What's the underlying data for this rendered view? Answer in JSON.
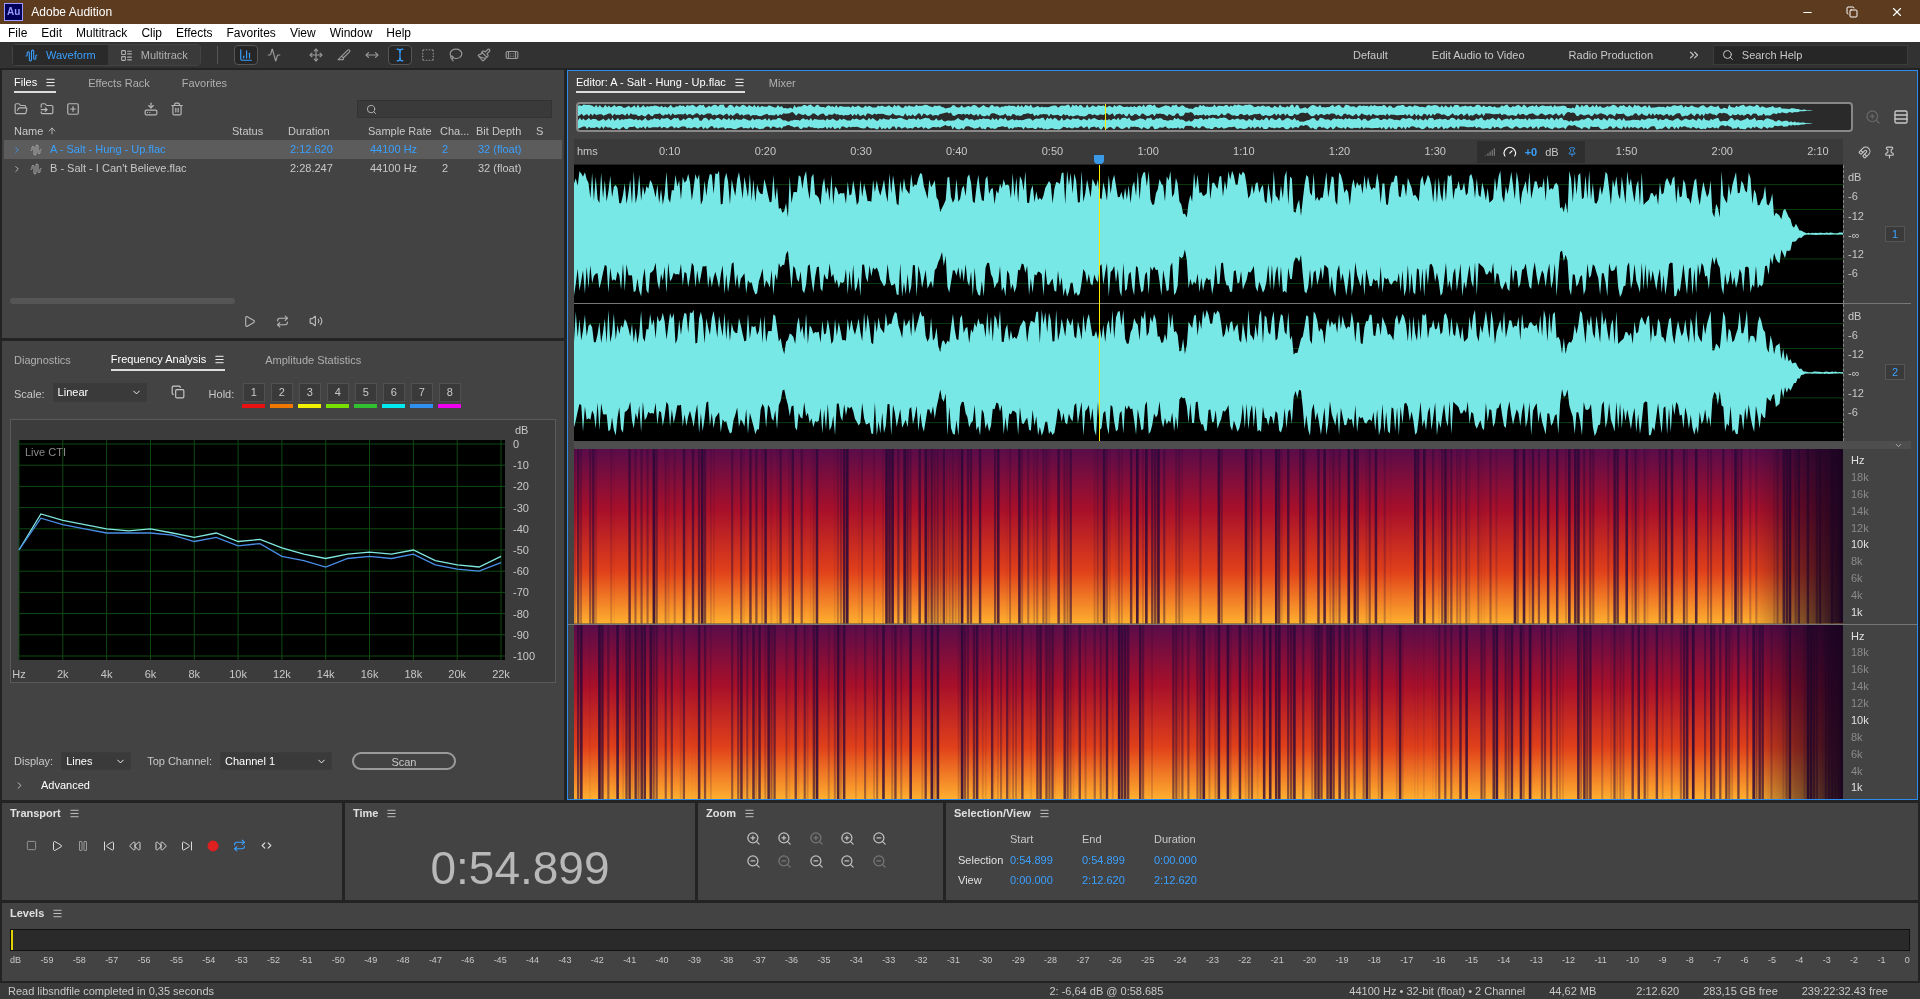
{
  "window": {
    "app_icon": "Au",
    "title": "Adobe Audition"
  },
  "menu": [
    "File",
    "Edit",
    "Multitrack",
    "Clip",
    "Effects",
    "Favorites",
    "View",
    "Window",
    "Help"
  ],
  "toolbar": {
    "modes": [
      {
        "label": "Waveform",
        "selected": true
      },
      {
        "label": "Multitrack",
        "selected": false
      }
    ],
    "workspaces": [
      "Default",
      "Edit Audio to Video",
      "Radio Production"
    ],
    "search": {
      "placeholder": "Search Help"
    }
  },
  "files_panel": {
    "tabs": [
      {
        "label": "Files",
        "selected": true
      },
      {
        "label": "Effects Rack",
        "selected": false
      },
      {
        "label": "Favorites",
        "selected": false
      }
    ],
    "columns": [
      "Name",
      "Status",
      "Duration",
      "Sample Rate",
      "Cha...",
      "Bit Depth",
      "S"
    ],
    "rows": [
      {
        "name": "A - Salt - Hung - Up.flac",
        "duration": "2:12.620",
        "sample_rate": "44100 Hz",
        "channels": "2",
        "bit_depth": "32 (float)",
        "selected": true
      },
      {
        "name": "B - Salt - I Can't Believe.flac",
        "duration": "2:28.247",
        "sample_rate": "44100 Hz",
        "channels": "2",
        "bit_depth": "32 (float)",
        "selected": false
      }
    ]
  },
  "analysis_panel": {
    "tabs": [
      {
        "label": "Diagnostics",
        "selected": false
      },
      {
        "label": "Frequency Analysis",
        "selected": true
      },
      {
        "label": "Amplitude Statistics",
        "selected": false
      }
    ],
    "scale_label": "Scale:",
    "scale": "Linear",
    "hold_label": "Hold:",
    "hold": [
      {
        "label": "1",
        "color": "#e81010"
      },
      {
        "label": "2",
        "color": "#f07800"
      },
      {
        "label": "3",
        "color": "#f0f000"
      },
      {
        "label": "4",
        "color": "#78e000"
      },
      {
        "label": "5",
        "color": "#30c030"
      },
      {
        "label": "6",
        "color": "#00e8f0"
      },
      {
        "label": "7",
        "color": "#3090f0"
      },
      {
        "label": "8",
        "color": "#f000f0"
      }
    ],
    "live_label": "Live CTI",
    "chart_data": {
      "type": "line",
      "grid": true,
      "ylabel": "dB",
      "xlim": [
        0,
        22000
      ],
      "ylim": [
        -100,
        0
      ],
      "x": [
        0,
        1000,
        2000,
        3000,
        4000,
        5000,
        6000,
        7000,
        8000,
        9000,
        10000,
        11000,
        12000,
        13000,
        14000,
        15000,
        16000,
        17000,
        18000,
        19000,
        20000,
        21000,
        22000
      ],
      "series": [
        {
          "color": "#80e8e0",
          "values": [
            -50,
            -33,
            -36,
            -38,
            -40,
            -41,
            -40,
            -42,
            -44,
            -42,
            -46,
            -45,
            -49,
            -52,
            -54,
            -52,
            -51,
            -52,
            -50,
            -55,
            -57,
            -58,
            -53
          ]
        },
        {
          "color": "#4a8ee8",
          "values": [
            -50,
            -35,
            -38,
            -40,
            -42,
            -42,
            -42,
            -43,
            -46,
            -44,
            -48,
            -47,
            -53,
            -55,
            -58,
            -54,
            -53,
            -54,
            -52,
            -57,
            -59,
            -60,
            -56
          ]
        }
      ],
      "xticks": [
        {
          "value": 0,
          "label": "Hz"
        },
        {
          "value": 2000,
          "label": "2k"
        },
        {
          "value": 4000,
          "label": "4k"
        },
        {
          "value": 6000,
          "label": "6k"
        },
        {
          "value": 8000,
          "label": "8k"
        },
        {
          "value": 10000,
          "label": "10k"
        },
        {
          "value": 12000,
          "label": "12k"
        },
        {
          "value": 14000,
          "label": "14k"
        },
        {
          "value": 16000,
          "label": "16k"
        },
        {
          "value": 18000,
          "label": "18k"
        },
        {
          "value": 20000,
          "label": "20k"
        },
        {
          "value": 22000,
          "label": "22k"
        }
      ],
      "yticks": [
        0,
        -10,
        -20,
        -30,
        -40,
        -50,
        -60,
        -70,
        -80,
        -90,
        -100
      ]
    },
    "display_label": "Display:",
    "display": "Lines",
    "top_channel_label": "Top Channel:",
    "top_channel": "Channel 1",
    "scan": "Scan",
    "advanced": "Advanced"
  },
  "editor": {
    "tabs": [
      {
        "label": "Editor: A - Salt - Hung - Up.flac",
        "selected": true
      },
      {
        "label": "Mixer",
        "selected": false
      }
    ],
    "ruler_unit": "hms",
    "ruler": [
      "0:10",
      "0:20",
      "0:30",
      "0:40",
      "0:50",
      "1:00",
      "1:10",
      "1:20",
      "1:30",
      "1:50",
      "2:00",
      "2:10"
    ],
    "playhead": {
      "level": 0.414
    },
    "gain": "+0",
    "gain_unit": "dB",
    "channels": [
      {
        "badge": "1",
        "labels": [
          "dB",
          "-6",
          "-12",
          "-∞",
          "-12",
          "-6"
        ]
      },
      {
        "badge": "2",
        "labels": [
          "dB",
          "-6",
          "-12",
          "-∞",
          "-12",
          "-6"
        ]
      }
    ],
    "spectral": [
      {
        "labels": [
          "Hz",
          "18k",
          "16k",
          "14k",
          "12k",
          "10k",
          "8k",
          "6k",
          "4k",
          "1k"
        ]
      },
      {
        "labels": [
          "Hz",
          "18k",
          "16k",
          "14k",
          "12k",
          "10k",
          "8k",
          "6k",
          "4k",
          "1k"
        ]
      }
    ]
  },
  "transport": {
    "title": "Transport",
    "loop_on": true
  },
  "time": {
    "title": "Time",
    "value": "0:54.899"
  },
  "zoom": {
    "title": "Zoom"
  },
  "selection_view": {
    "title": "Selection/View",
    "columns": [
      "Start",
      "End",
      "Duration"
    ],
    "rows": [
      {
        "label": "Selection",
        "values": [
          "0:54.899",
          "0:54.899",
          "0:00.000"
        ]
      },
      {
        "label": "View",
        "values": [
          "0:00.000",
          "2:12.620",
          "2:12.620"
        ]
      }
    ]
  },
  "levels": {
    "title": "Levels",
    "ticks": [
      "dB",
      "-59",
      "-58",
      "-57",
      "-56",
      "-55",
      "-54",
      "-53",
      "-52",
      "-51",
      "-50",
      "-49",
      "-48",
      "-47",
      "-46",
      "-45",
      "-44",
      "-43",
      "-42",
      "-41",
      "-40",
      "-39",
      "-38",
      "-37",
      "-36",
      "-35",
      "-34",
      "-33",
      "-32",
      "-31",
      "-30",
      "-29",
      "-28",
      "-27",
      "-26",
      "-25",
      "-24",
      "-23",
      "-22",
      "-21",
      "-20",
      "-19",
      "-18",
      "-17",
      "-16",
      "-15",
      "-14",
      "-13",
      "-12",
      "-11",
      "-10",
      "-9",
      "-8",
      "-7",
      "-6",
      "-5",
      "-4",
      "-3",
      "-2",
      "-1",
      "0"
    ]
  },
  "status_bar": {
    "message": "Read libsndfile completed in 0,35 seconds",
    "cursor": "2: -6,64 dB @ 0:58.685",
    "format": "44100 Hz • 32-bit (float) • 2 Channel",
    "size": "44,62 MB",
    "duration": "2:12.620",
    "disk_free": "283,15 GB free",
    "time_free": "239:22:32.43 free"
  }
}
